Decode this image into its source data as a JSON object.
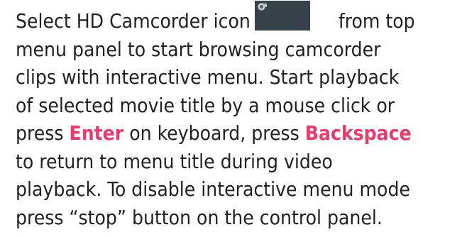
{
  "instructions": {
    "line1_before_icon": "Select HD Camcorder icon",
    "line1_after_icon": "from top",
    "line2": "menu panel to start browsing camcorder",
    "line3": "clips with interactive menu. Start playback",
    "line4": "of selected movie title by a mouse click or",
    "line5_before_enter": "press ",
    "line5_enter_key": "Enter",
    "line5_between": " on keyboard, press ",
    "line5_backspace_key": "Backspace",
    "line6": "to return to menu title during video",
    "line7": "playback. To disable interactive menu mode",
    "line8": "press “stop” button on the control panel.",
    "key_highlight_color": "#e83a6b",
    "icon": "hd-camcorder-icon"
  }
}
